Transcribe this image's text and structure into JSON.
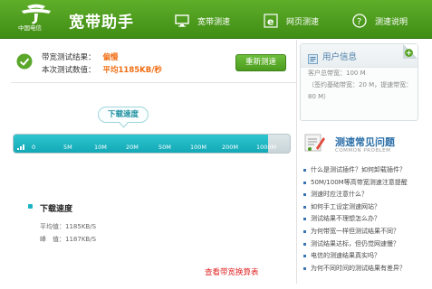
{
  "header": {
    "logo_text": "中国电信",
    "logo_subtext": "China Telecom",
    "title": "宽带助手",
    "nav": [
      {
        "label": "宽带测速",
        "icon": "monitor-icon"
      },
      {
        "label": "网页测速",
        "icon": "ie-browser-icon"
      },
      {
        "label": "测速说明",
        "icon": "help-icon"
      }
    ],
    "colors": {
      "header": "#4a9a1e"
    }
  },
  "result": {
    "label1": "带宽测试结果：",
    "value1": "偏慢",
    "label2": "本次测试数值：",
    "value2": "平均1185KB/秒",
    "retest_label": "重新测速",
    "accent": "#f06d12"
  },
  "speed": {
    "bubble_label": "下载速度",
    "gauge_fill_fraction": 0.09,
    "ticks": [
      "0",
      "5M",
      "10M",
      "20M",
      "50M",
      "100M",
      "200M",
      "1000M"
    ],
    "detail_title": "下载速度",
    "avg_label": "平均值：",
    "avg_value": "1185KB/S",
    "peak_label": "峰　值：",
    "peak_value": "1187KB/S",
    "link_label": "查看带宽换算表"
  },
  "user_info": {
    "title": "用户信息",
    "line1": "客户总带宽：100 M",
    "line2": "（签约基础带宽：20 M，提速带宽：",
    "line3": "80 M）"
  },
  "faq": {
    "title": "测速常见问题",
    "subtitle": "COMMON PROBLEM",
    "items": [
      "什么是测试插件？如何卸载插件？",
      "50M/100M等高带宽测速注意提醒",
      "测速时应注意什么？",
      "如何手工设定测速网站？",
      "测试结果不理想怎么办？",
      "为何带宽一样但测试结果不同？",
      "测试结果达标，但仍觉网速慢？",
      "电信的测速结果真实吗？",
      "为何不同时间的测试结果有差异？"
    ]
  }
}
